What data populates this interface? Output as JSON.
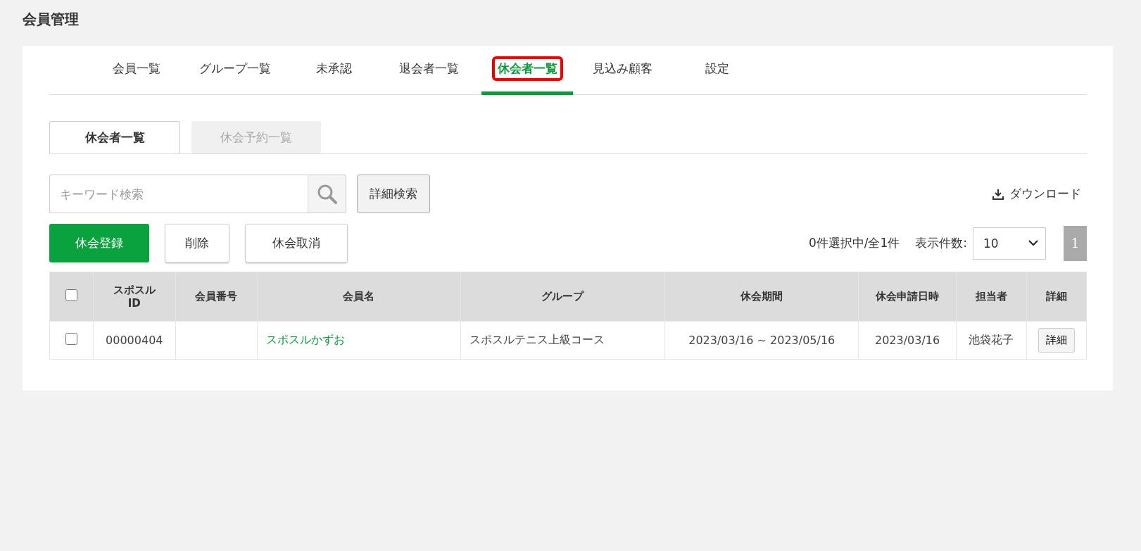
{
  "page_title": "会員管理",
  "tabs": [
    {
      "label": "会員一覧",
      "selected": false,
      "highlighted": false
    },
    {
      "label": "グループ一覧",
      "selected": false,
      "highlighted": false
    },
    {
      "label": "未承認",
      "selected": false,
      "highlighted": false
    },
    {
      "label": "退会者一覧",
      "selected": false,
      "highlighted": false
    },
    {
      "label": "休会者一覧",
      "selected": true,
      "highlighted": true
    },
    {
      "label": "見込み顧客",
      "selected": false,
      "highlighted": false
    },
    {
      "label": "設定",
      "selected": false,
      "highlighted": false
    }
  ],
  "sub_tabs": [
    {
      "label": "休会者一覧",
      "selected": true
    },
    {
      "label": "休会予約一覧",
      "selected": false
    }
  ],
  "search": {
    "placeholder": "キーワード検索",
    "advanced_button": "詳細検索"
  },
  "download": "ダウンロード",
  "actions": [
    {
      "label": "休会登録",
      "kind": "primary"
    },
    {
      "label": "削除",
      "kind": "default"
    },
    {
      "label": "休会取消",
      "kind": "default"
    }
  ],
  "selection_count": "0件選択中/全1件",
  "per_page": {
    "label": "表示件数:",
    "value": "10"
  },
  "pages": [
    {
      "label": "1",
      "selected": true
    }
  ],
  "table": {
    "columns": [
      "スポスル ID",
      "会員番号",
      "会員名",
      "グループ",
      "休会期間",
      "休会申請日時",
      "担当者",
      "詳細"
    ],
    "header_checked": false,
    "rows": [
      {
        "checked": false,
        "cells": [
          "00000404",
          "",
          "スポスルかずお",
          "スポスルテニス上級コース",
          "2023/03/16 ~ 2023/05/16",
          "2023/03/16",
          "池袋花子"
        ],
        "detail_button": "詳細"
      }
    ]
  }
}
